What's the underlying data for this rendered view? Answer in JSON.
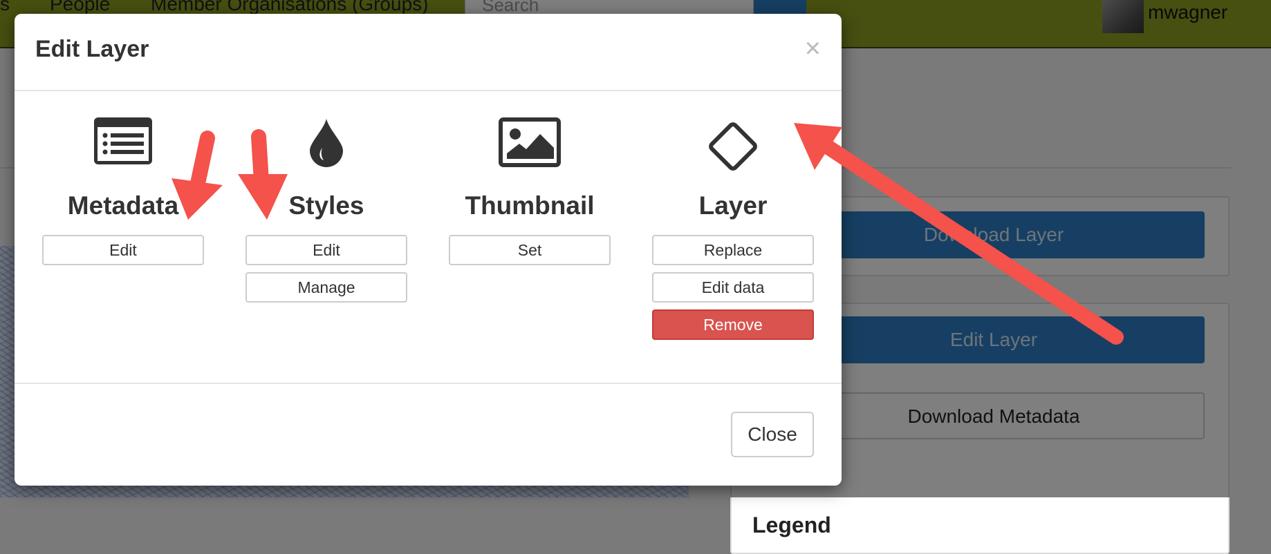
{
  "background": {
    "nav": [
      "s",
      "People",
      "Member Organisations (Groups)"
    ],
    "search_placeholder": "Search",
    "username": "mwagner",
    "download_layer": "Download Layer",
    "edit_layer": "Edit Layer",
    "download_metadata": "Download Metadata",
    "legend": "Legend"
  },
  "modal": {
    "title": "Edit Layer",
    "close_x": "×",
    "close_button": "Close",
    "sections": [
      {
        "icon": "metadata-list-icon",
        "heading": "Metadata",
        "buttons": [
          "Edit"
        ]
      },
      {
        "icon": "tint-drop-icon",
        "heading": "Styles",
        "buttons": [
          "Edit",
          "Manage"
        ]
      },
      {
        "icon": "image-icon",
        "heading": "Thumbnail",
        "buttons": [
          "Set"
        ]
      },
      {
        "icon": "diamond-icon",
        "heading": "Layer",
        "buttons": [
          "Replace",
          "Edit data",
          "Remove"
        ]
      }
    ]
  },
  "colors": {
    "nav_bar": "#8fa021",
    "primary": "#2c7fc6",
    "danger": "#d9534f",
    "annotation_arrow": "#f4524a"
  }
}
